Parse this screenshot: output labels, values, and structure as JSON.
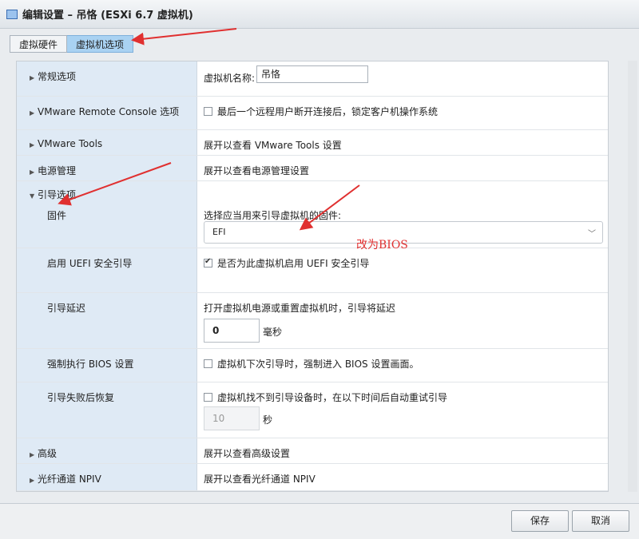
{
  "window": {
    "title": "编辑设置 – 吊恪 (ESXi 6.7 虚拟机)"
  },
  "tabs": [
    {
      "label": "虚拟硬件"
    },
    {
      "label": "虚拟机选项"
    }
  ],
  "sections": {
    "general": {
      "label": "常规选项",
      "name_label": "虚拟机名称:",
      "name_value": "吊恪"
    },
    "vmrc": {
      "label": "VMware Remote Console 选项",
      "checkbox_text": "最后一个远程用户断开连接后，锁定客户机操作系统"
    },
    "tools": {
      "label": "VMware Tools",
      "text": "展开以查看 VMware Tools 设置"
    },
    "power": {
      "label": "电源管理",
      "text": "展开以查看电源管理设置"
    },
    "boot": {
      "label": "引导选项",
      "firmware": {
        "label": "固件",
        "prompt": "选择应当用来引导虚拟机的固件:",
        "selected": "EFI"
      },
      "secure_boot": {
        "label": "启用 UEFI 安全引导",
        "checkbox_text": "是否为此虚拟机启用 UEFI 安全引导",
        "checked": true
      },
      "boot_delay": {
        "label": "引导延迟",
        "text": "打开虚拟机电源或重置虚拟机时，引导将延迟",
        "value": "0",
        "unit": "毫秒"
      },
      "force_bios": {
        "label": "强制执行 BIOS 设置",
        "checkbox_text": "虚拟机下次引导时，强制进入 BIOS 设置画面。"
      },
      "failed_recovery": {
        "label": "引导失败后恢复",
        "checkbox_text": "虚拟机找不到引导设备时，在以下时间后自动重试引导",
        "value": "10",
        "unit": "秒"
      }
    },
    "advanced": {
      "label": "高级",
      "text": "展开以查看高级设置"
    },
    "npiv": {
      "label": "光纤通道 NPIV",
      "text": "展开以查看光纤通道 NPIV"
    }
  },
  "annotation": {
    "text": "改为BIOS"
  },
  "footer": {
    "save_label": "保存",
    "cancel_label": "取消"
  },
  "colors": {
    "annotation": "#e03030",
    "active_tab": "#a9d2f2",
    "label_bg": "#dfeaf5"
  }
}
